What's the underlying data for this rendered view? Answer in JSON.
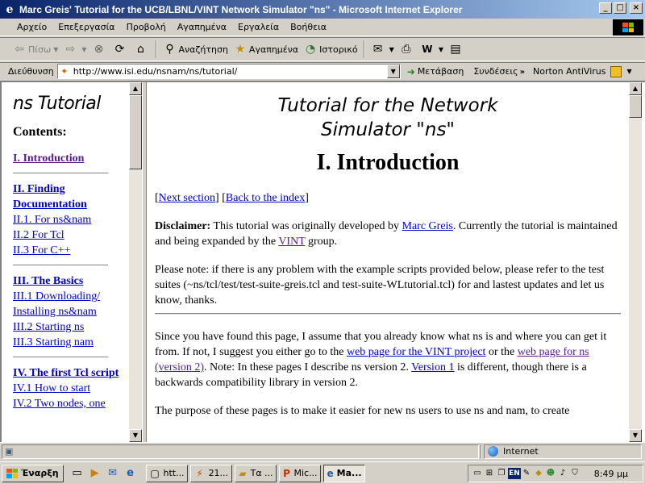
{
  "window": {
    "title": "Marc Greis' Tutorial for the UCB/LBNL/VINT Network Simulator \"ns\" - Microsoft Internet Explorer",
    "minimize": "_",
    "maximize": "□",
    "close": "×"
  },
  "menu": [
    "Αρχείο",
    "Επεξεργασία",
    "Προβολή",
    "Αγαπημένα",
    "Εργαλεία",
    "Βοήθεια"
  ],
  "toolbar": {
    "back": "Πίσω",
    "search": "Αναζήτηση",
    "favorites": "Αγαπημένα",
    "history": "Ιστορικό"
  },
  "address": {
    "label": "Διεύθυνση",
    "url": "http://www.isi.edu/nsnam/ns/tutorial/",
    "go": "Μετάβαση",
    "links": "Συνδέσεις",
    "antivirus": "Norton AntiVirus"
  },
  "sidebar": {
    "title": "ns Tutorial",
    "contents_heading": "Contents:",
    "items": [
      {
        "text": "I. Introduction"
      },
      {
        "text": "II. Finding Documentation"
      },
      {
        "text": "II.1. For ns&nam"
      },
      {
        "text": "II.2 For Tcl"
      },
      {
        "text": "II.3 For C++"
      },
      {
        "text": "III. The Basics"
      },
      {
        "text": "III.1 Downloading/ Installing ns&nam"
      },
      {
        "text": "III.2 Starting ns"
      },
      {
        "text": "III.3 Starting nam"
      },
      {
        "text": "IV. The first Tcl script"
      },
      {
        "text": "IV.1 How to start"
      },
      {
        "text": "IV.2 Two nodes, one"
      }
    ]
  },
  "main": {
    "title_line1": "Tutorial for the Network",
    "title_line2": "Simulator \"ns\"",
    "heading": "I. Introduction",
    "nav": {
      "open": "[",
      "next": "Next section",
      "mid": "] [",
      "back": "Back to the index",
      "close": "]"
    },
    "disclaimer": {
      "label": "Disclaimer:",
      "text1": " This tutorial was originally developed by ",
      "author": "Marc Greis",
      "text2": ". Currently the tutorial is maintained and being expanded by the ",
      "vint": "VINT",
      "text3": " group."
    },
    "note": "Please note: if there is any problem with the example scripts provided below, please refer to the test suites (~ns/tcl/test/test-suite-greis.tcl and test-suite-WLtutorial.tcl) for and lastest updates and let us know, thanks.",
    "para1": {
      "text1": "Since you have found this page, I assume that you already know what ns is and where you can get it from. If not, I suggest you either go to the ",
      "link1": "web page for the VINT project",
      "text2": " or the ",
      "link2": "web page for ns (version 2)",
      "text3": ". Note: In these pages I describe ns version 2. ",
      "link3": "Version 1",
      "text4": " is different, though there is a backwards compatibility library in version 2."
    },
    "para2": "The purpose of these pages is to make it easier for new ns users to use ns and nam, to create"
  },
  "status": {
    "zone": "Internet"
  },
  "taskbar": {
    "start": "Έναρξη",
    "tasks": [
      "htt...",
      "21...",
      "Τα ...",
      "Mic...",
      "Ma..."
    ],
    "lang": "EN",
    "clock": "8:49 μμ"
  },
  "colors": {
    "titlebar_start": "#0a246a",
    "titlebar_end": "#a6caf0",
    "link": "#0000cc",
    "visited": "#551a8b"
  }
}
